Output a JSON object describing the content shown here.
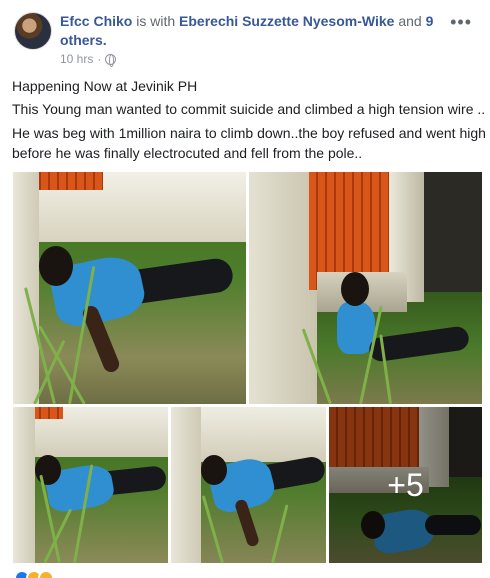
{
  "post": {
    "author": "Efcc Chiko",
    "with_text": "is with",
    "tagged_person": "Eberechi Suzzette Nyesom-Wike",
    "and_text": "and",
    "others_link": "9 others.",
    "timestamp": "10 hrs",
    "separator": "·",
    "privacy_icon": "globe-icon",
    "menu_icon": "more-options-icon",
    "menu_glyph": "•••",
    "lines": [
      "Happening Now at Jevinik PH",
      "This Young man wanted to commit suicide and climbed a high tension wire ..",
      "He was beg with 1million naira to climb down..the boy refused and went high before he was finally electrocuted and fell from the pole.."
    ]
  },
  "photos": {
    "more_overlay": "+5"
  },
  "colors": {
    "link": "#385898",
    "meta": "#90949c",
    "text": "#1c1e21",
    "shirt": "#2f8fd1",
    "fence": "#d9561b"
  }
}
